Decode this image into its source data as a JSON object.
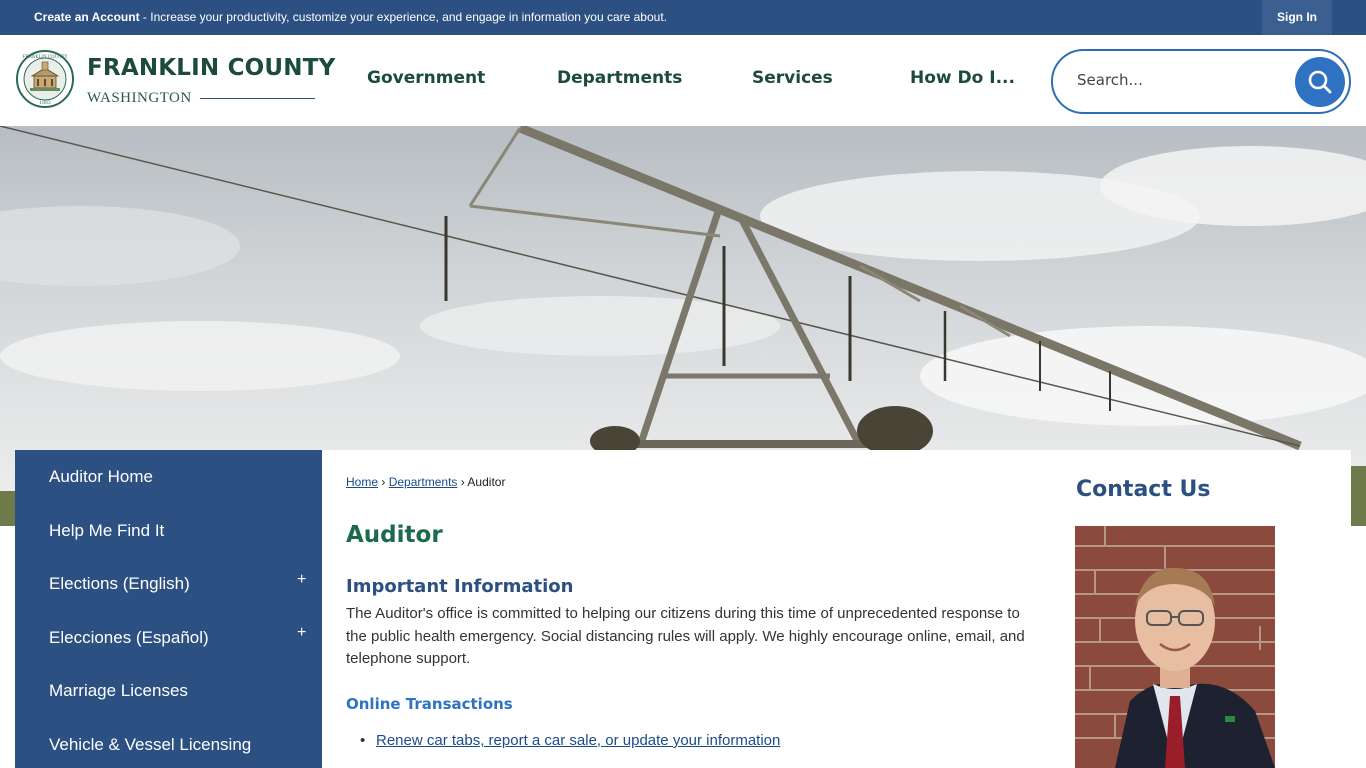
{
  "topbar": {
    "create_account": "Create an Account",
    "promo_text": " - Increase your productivity, customize your experience, and engage in information you care about.",
    "sign_in": "Sign In"
  },
  "logo": {
    "name": "FRANKLIN COUNTY",
    "subtitle": "WASHINGTON",
    "seal_top": "FRANKLIN COUNTY",
    "seal_year": "1883"
  },
  "nav": {
    "items": [
      "Government",
      "Departments",
      "Services",
      "How Do I..."
    ]
  },
  "search": {
    "placeholder": "Search..."
  },
  "sidebar": {
    "items": [
      {
        "label": "Auditor Home"
      },
      {
        "label": "Help Me Find It"
      },
      {
        "label": "Elections (English)",
        "expand": "+"
      },
      {
        "label": "Elecciones (Español)",
        "expand": "+"
      },
      {
        "label": "Marriage Licenses"
      },
      {
        "label": "Vehicle & Vessel Licensing"
      }
    ]
  },
  "breadcrumb": {
    "home": "Home",
    "sep": "›",
    "departments": "Departments",
    "current": "Auditor"
  },
  "page": {
    "title": "Auditor",
    "subheading": "Important Information",
    "paragraph": "The Auditor's office is committed to helping our citizens during this time of unprecedented response to the public health emergency. Social distancing rules will apply. We highly encourage online, email, and telephone support.",
    "online_heading": "Online Transactions",
    "links": [
      "Renew car tabs, report a car sale, or update your information"
    ]
  },
  "contact": {
    "title": "Contact Us"
  },
  "colors": {
    "primary_blue": "#2c5082",
    "accent_green": "#1c6a4c",
    "search_blue": "#2f72c2"
  }
}
